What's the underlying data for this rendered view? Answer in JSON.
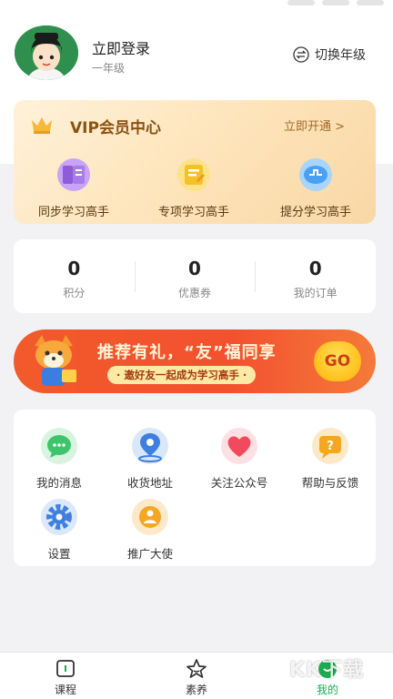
{
  "header": {
    "user_name": "立即登录",
    "grade": "一年级",
    "switch_grade_label": "切换年级"
  },
  "vip": {
    "title": "VIP会员中心",
    "open_label": "立即开通 >",
    "items": [
      {
        "label": "同步学习高手",
        "icon": "books-icon"
      },
      {
        "label": "专项学习高手",
        "icon": "notebook-icon"
      },
      {
        "label": "提分学习高手",
        "icon": "score-up-icon"
      }
    ]
  },
  "stats": [
    {
      "value": "0",
      "label": "积分"
    },
    {
      "value": "0",
      "label": "优惠券"
    },
    {
      "value": "0",
      "label": "我的订单"
    }
  ],
  "banner": {
    "title": "推荐有礼，“友”福同享",
    "subtitle": "· 邀好友一起成为学习高手 ·",
    "go_label": "GO"
  },
  "menu": {
    "items": [
      {
        "label": "我的消息",
        "icon": "message-icon"
      },
      {
        "label": "收货地址",
        "icon": "location-icon"
      },
      {
        "label": "关注公众号",
        "icon": "heart-icon"
      },
      {
        "label": "帮助与反馈",
        "icon": "help-icon"
      },
      {
        "label": "设置",
        "icon": "settings-icon"
      },
      {
        "label": "推广大使",
        "icon": "ambassador-icon"
      }
    ]
  },
  "bottom_nav": {
    "items": [
      {
        "label": "课程",
        "icon": "course-icon"
      },
      {
        "label": "素养",
        "icon": "star-icon"
      },
      {
        "label": "我的",
        "icon": "profile-icon",
        "active": true
      }
    ]
  },
  "watermark": "KK下载",
  "colors": {
    "accent_green": "#1faa52",
    "vip_gold": "#8a5312",
    "banner_orange": "#f25a2b"
  }
}
